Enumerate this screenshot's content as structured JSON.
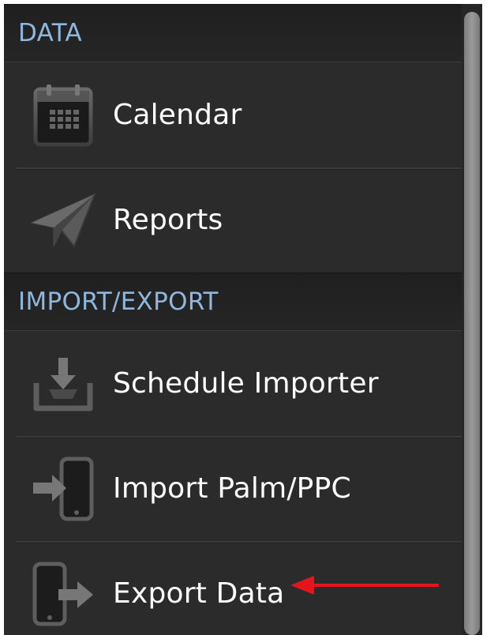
{
  "sections": [
    {
      "header": "DATA",
      "items": [
        {
          "label": "Calendar",
          "icon": "calendar-icon"
        },
        {
          "label": "Reports",
          "icon": "paper-plane-icon"
        }
      ]
    },
    {
      "header": "IMPORT/EXPORT",
      "items": [
        {
          "label": "Schedule Importer",
          "icon": "download-tray-icon"
        },
        {
          "label": "Import Palm/PPC",
          "icon": "import-device-icon"
        },
        {
          "label": "Export Data",
          "icon": "export-device-icon"
        }
      ]
    }
  ],
  "colors": {
    "header_text": "#8fb7de",
    "item_text": "#ffffff",
    "panel_bg": "#2b2b2b",
    "annotation_arrow": "#e8141c"
  }
}
